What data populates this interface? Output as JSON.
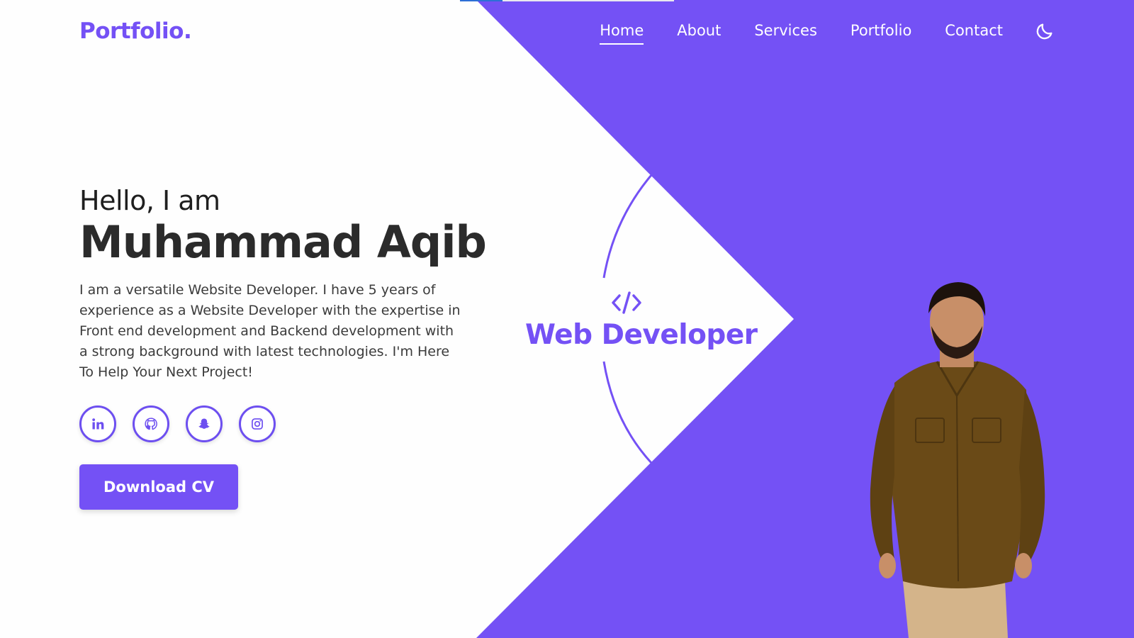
{
  "brand": {
    "logo": "Portfolio.",
    "accent_color": "#7451f5"
  },
  "nav": {
    "items": [
      {
        "label": "Home",
        "active": true
      },
      {
        "label": "About",
        "active": false
      },
      {
        "label": "Services",
        "active": false
      },
      {
        "label": "Portfolio",
        "active": false
      },
      {
        "label": "Contact",
        "active": false
      }
    ],
    "theme_toggle_icon": "moon-icon"
  },
  "hero": {
    "greeting": "Hello, I am",
    "name": "Muhammad Aqib",
    "bio": "I am a versatile Website Developer. I have 5 years of experience as a Website Developer with the expertise in Front end development and Backend development with a strong background with latest technologies. I'm Here To Help Your Next Project!",
    "socials": [
      {
        "icon": "linkedin-icon"
      },
      {
        "icon": "github-icon"
      },
      {
        "icon": "snapchat-icon"
      },
      {
        "icon": "instagram-icon"
      }
    ],
    "download_label": "Download CV"
  },
  "role": {
    "icon": "code-icon",
    "title": "Web Developer"
  },
  "portrait": {
    "icon": "person-photo"
  }
}
